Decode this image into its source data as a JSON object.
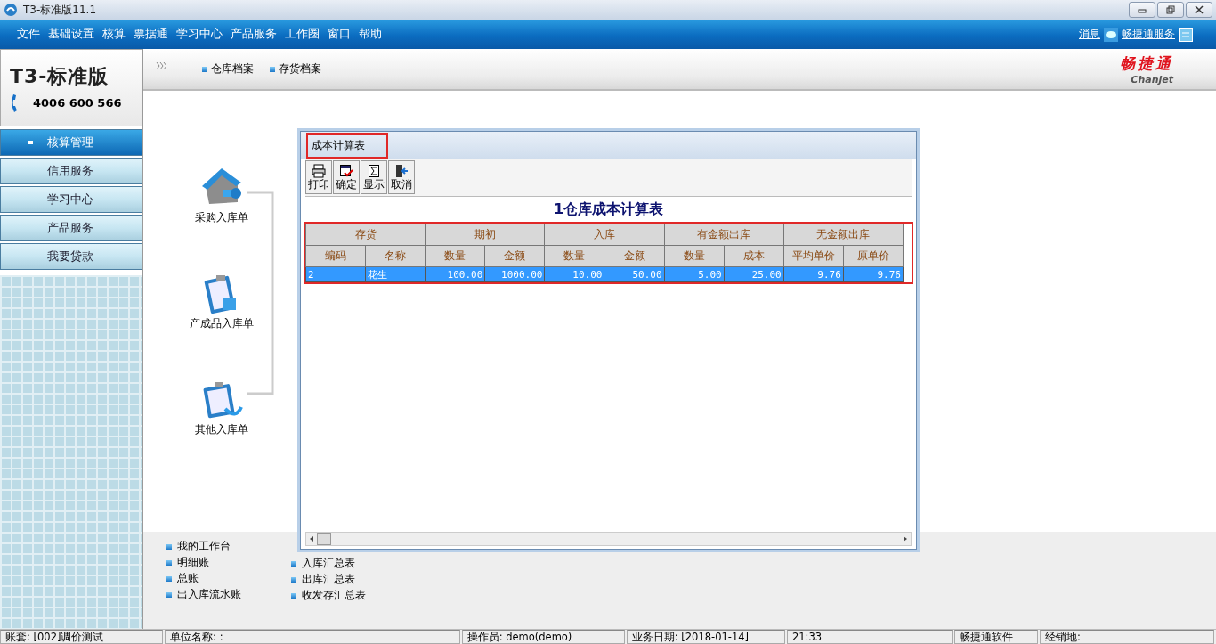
{
  "window": {
    "title": "T3-标准版11.1"
  },
  "menu": [
    "文件",
    "基础设置",
    "核算",
    "票据通",
    "学习中心",
    "产品服务",
    "工作圈",
    "窗口",
    "帮助"
  ],
  "top_links": [
    {
      "label": "消息",
      "kind": "message"
    },
    {
      "label": "畅捷通服务",
      "kind": "service"
    }
  ],
  "brand": {
    "product": "T3-标准版",
    "phone": "4006 600 566",
    "company": "畅捷通",
    "company_en": "Chanjet"
  },
  "breadcrumb": [
    "仓库档案",
    "存货档案"
  ],
  "sidebar": {
    "items": [
      {
        "label": "核算管理",
        "selected": true
      },
      {
        "label": "信用服务",
        "selected": false
      },
      {
        "label": "学习中心",
        "selected": false
      },
      {
        "label": "产品服务",
        "selected": false
      },
      {
        "label": "我要贷款",
        "selected": false
      }
    ]
  },
  "flow": [
    {
      "label": "采购入库单",
      "kind": "house"
    },
    {
      "label": "产成品入库单",
      "kind": "clipboard"
    },
    {
      "label": "其他入库单",
      "kind": "clipboard-return"
    }
  ],
  "dialog": {
    "title": "成本计算表",
    "title_highlighted": true,
    "toolbar": [
      {
        "label": "打印",
        "kind": "print"
      },
      {
        "label": "确定",
        "kind": "confirm"
      },
      {
        "label": "显示",
        "kind": "sum"
      },
      {
        "label": "取消",
        "kind": "exit"
      }
    ],
    "report_title": "1仓库成本计算表",
    "table": {
      "highlighted": true,
      "groups": [
        "存货",
        "期初",
        "入库",
        "有金额出库",
        "无金额出库"
      ],
      "columns": [
        "编码",
        "名称",
        "数量",
        "金额",
        "数量",
        "金额",
        "数量",
        "成本",
        "平均单价",
        "原单价"
      ],
      "rows": [
        {
          "cells": [
            "2",
            "花生",
            "100.00",
            "1000.00",
            "10.00",
            "50.00",
            "5.00",
            "25.00",
            "9.76",
            "9.76"
          ],
          "selected": true
        }
      ]
    }
  },
  "bottom_links": [
    [
      "我的工作台",
      "明细账",
      "总账",
      "出入库流水账"
    ],
    [
      "入库汇总表",
      "出库汇总表",
      "收发存汇总表"
    ]
  ],
  "status_bar": [
    "账套: [002]调价测试",
    "单位名称: :",
    "操作员: demo(demo)",
    "业务日期: [2018-01-14]",
    "21:33",
    "畅捷通软件",
    "经销地:"
  ]
}
